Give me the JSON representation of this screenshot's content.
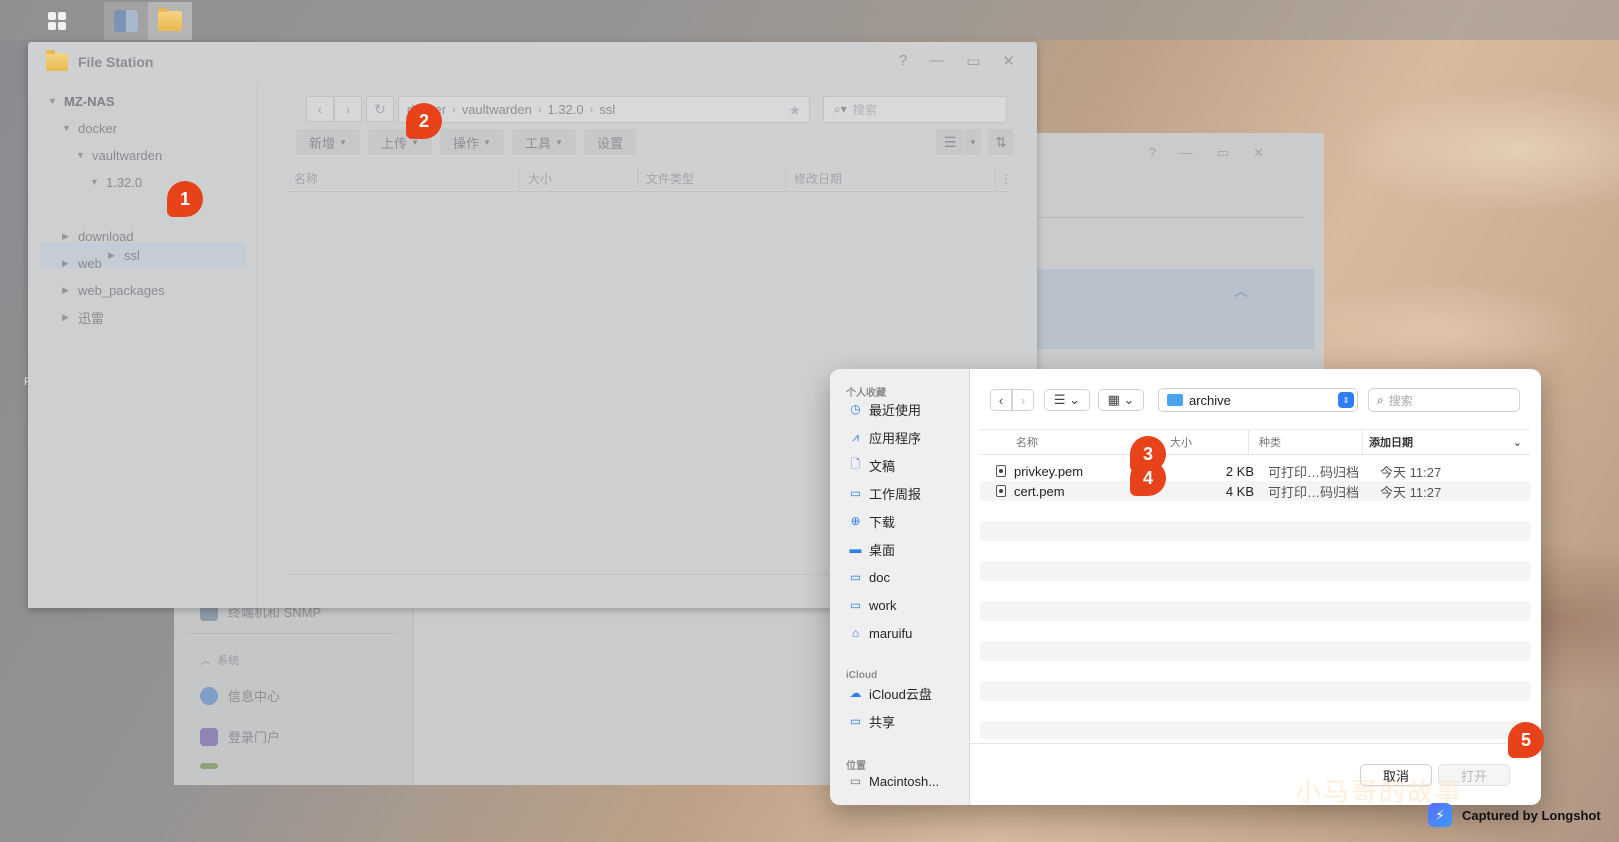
{
  "colors": {
    "badge": "#e8421b",
    "accent": "#2f7ef5",
    "folder": "#e8b94d"
  },
  "taskbar": {
    "icons": [
      "grid-icon",
      "control-panel-icon",
      "file-station-icon"
    ]
  },
  "background_window": {
    "items": [
      {
        "label": "终端机和 SNMP",
        "icon": "terminal-icon"
      },
      {
        "label": "信息中心",
        "icon": "info-icon"
      },
      {
        "label": "登录门户",
        "icon": "portal-icon"
      }
    ],
    "section_system": "系统"
  },
  "file_station": {
    "title": "File Station",
    "controls": {
      "help": "?",
      "minimize": "—",
      "maximize": "▭",
      "close": "✕"
    },
    "tree": [
      {
        "label": "MZ-NAS",
        "level": 0,
        "expanded": true
      },
      {
        "label": "docker",
        "level": 1,
        "expanded": true
      },
      {
        "label": "vaultwarden",
        "level": 2,
        "expanded": true
      },
      {
        "label": "1.32.0",
        "level": 3,
        "expanded": true
      },
      {
        "label": "ssl",
        "level": 4,
        "expanded": false,
        "selected": true
      },
      {
        "label": "download",
        "level": 1,
        "expanded": false
      },
      {
        "label": "web",
        "level": 1,
        "expanded": false
      },
      {
        "label": "web_packages",
        "level": 1,
        "expanded": false
      },
      {
        "label": "迅雷",
        "level": 1,
        "expanded": false
      }
    ],
    "path": [
      "docker",
      "vaultwarden",
      "1.32.0",
      "ssl"
    ],
    "search_placeholder": "搜索",
    "toolbar": {
      "new": "新增",
      "upload": "上传",
      "action": "操作",
      "tools": "工具",
      "settings": "设置"
    },
    "columns": [
      "名称",
      "大小",
      "文件类型",
      "修改日期"
    ]
  },
  "badges": [
    "1",
    "2",
    "3",
    "4",
    "5"
  ],
  "mac_dialog": {
    "sidebar": {
      "favorites_title": "个人收藏",
      "favorites": [
        {
          "label": "最近使用",
          "icon": "clock-icon"
        },
        {
          "label": "应用程序",
          "icon": "apps-icon"
        },
        {
          "label": "文稿",
          "icon": "document-icon"
        },
        {
          "label": "工作周报",
          "icon": "folder-icon"
        },
        {
          "label": "下载",
          "icon": "download-icon"
        },
        {
          "label": "桌面",
          "icon": "desktop-icon"
        },
        {
          "label": "doc",
          "icon": "folder-icon"
        },
        {
          "label": "work",
          "icon": "folder-icon"
        },
        {
          "label": "maruifu",
          "icon": "home-icon"
        }
      ],
      "icloud_title": "iCloud",
      "icloud": [
        {
          "label": "iCloud云盘",
          "icon": "cloud-icon"
        },
        {
          "label": "共享",
          "icon": "shared-folder-icon"
        }
      ],
      "locations_title": "位置",
      "locations": [
        {
          "label": "Macintosh...",
          "icon": "disk-icon"
        }
      ]
    },
    "location": "archive",
    "search_placeholder": "搜索",
    "columns": {
      "name": "名称",
      "size": "大小",
      "kind": "种类",
      "date_added": "添加日期"
    },
    "files": [
      {
        "name": "privkey.pem",
        "size": "2 KB",
        "kind": "可打印…码归档",
        "date": "今天 11:27"
      },
      {
        "name": "cert.pem",
        "size": "4 KB",
        "kind": "可打印…码归档",
        "date": "今天 11:27"
      }
    ],
    "buttons": {
      "cancel": "取消",
      "open": "打开"
    }
  },
  "watermark": "小马哥的故事",
  "capture_label": "Captured by Longshot"
}
